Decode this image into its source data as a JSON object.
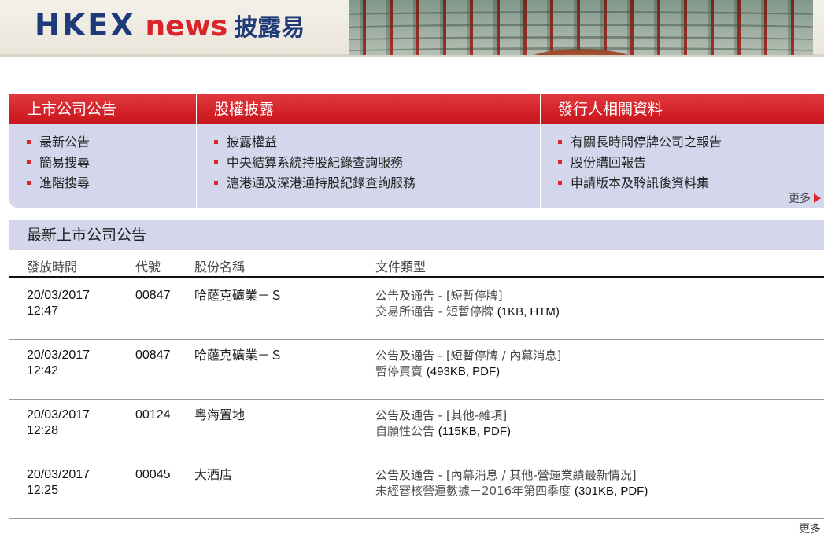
{
  "header": {
    "logo_hkex": "HKEX",
    "logo_news": "news",
    "logo_cn": "披露易"
  },
  "nav": {
    "columns": [
      {
        "title": "上市公司公告",
        "items": [
          "最新公告",
          "簡易搜尋",
          "進階搜尋"
        ]
      },
      {
        "title": "股權披露",
        "items": [
          "披露權益",
          "中央結算系統持股紀錄查詢服務",
          "滬港通及深港通持股紀錄查詢服務"
        ]
      },
      {
        "title": "發行人相關資料",
        "items": [
          "有關長時間停牌公司之報告",
          "股份購回報告",
          "申請版本及聆訊後資料集"
        ]
      }
    ],
    "more_label": "更多"
  },
  "announcements": {
    "title": "最新上市公司公告",
    "columns": {
      "time": "發放時間",
      "code": "代號",
      "name": "股份名稱",
      "type": "文件類型"
    },
    "rows": [
      {
        "date": "20/03/2017",
        "time": "12:47",
        "code": "00847",
        "name": "哈薩克礦業－Ｓ",
        "category": "公告及通告 - [短暫停牌]",
        "doc_title": "交易所通告 - 短暫停牌",
        "doc_size": "(1KB, HTM)"
      },
      {
        "date": "20/03/2017",
        "time": "12:42",
        "code": "00847",
        "name": "哈薩克礦業－Ｓ",
        "category": "公告及通告 - [短暫停牌 / 內幕消息]",
        "doc_title": "暫停買賣",
        "doc_size": "(493KB, PDF)"
      },
      {
        "date": "20/03/2017",
        "time": "12:28",
        "code": "00124",
        "name": "粵海置地",
        "category": "公告及通告 - [其他-雜項]",
        "doc_title": "自願性公告",
        "doc_size": "(115KB, PDF)"
      },
      {
        "date": "20/03/2017",
        "time": "12:25",
        "code": "00045",
        "name": "大酒店",
        "category": "公告及通告 - [內幕消息 / 其他-營運業績最新情況]",
        "doc_title": "未經審核營運數據－2016年第四季度",
        "doc_size": "(301KB, PDF)"
      }
    ],
    "more_label": "更多"
  },
  "colors": {
    "brand_blue": "#1e3a78",
    "brand_red": "#d9252a",
    "panel_lavender": "#d4d6ec"
  }
}
